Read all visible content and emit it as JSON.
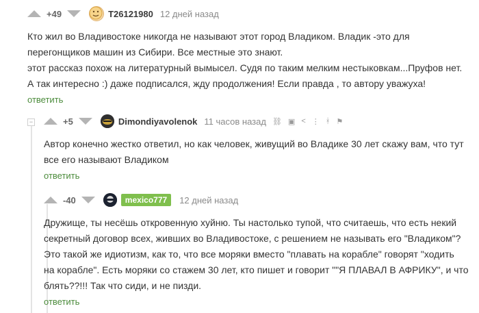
{
  "comments": [
    {
      "score": "+49",
      "author": "T26121980",
      "time": "12 дней назад",
      "lines": [
        "Кто жил во Владивостоке никогда не называют этот город Владиком. Владик -это для",
        "перегонщиков машин из Сибири. Все местные это знают.",
        "этот рассказ похож на литературный вымысел. Судя по таким мелким нестыковкам...Пруфов нет.",
        "А так интересно :) даже подписался, жду продолжения! Если правда , то автору уважуха!"
      ],
      "reply": "ответить"
    },
    {
      "score": "+5",
      "author": "Dimondiyavolenok",
      "time": "11 часов назад",
      "lines": [
        "Автор конечно жестко ответил, но как человек, живущий во Владике 30 лет скажу вам, что тут",
        "все его называют Владиком"
      ],
      "reply": "ответить",
      "tools": [
        "⛓",
        "▣",
        "<",
        "⋮",
        "ᚼ",
        "⚑"
      ]
    },
    {
      "score": "-40",
      "author": "mexico777",
      "time": "12 дней назад",
      "lines": [
        "Дружище, ты несёшь откровенную хуйню. Ты настолько тупой, что считаешь, что есть некий",
        "секретный договор всех, живших во Владивостоке, с решением не называть его \"Владиком\"?",
        "Это такой же идиотизм, как то, что все моряки вместо \"плавать на корабле\" говорят \"ходить",
        "на корабле\". Есть моряки со стажем 30 лет, кто пишет и говорит \"\"Я ПЛАВАЛ В АФРИКУ\", и что",
        "блять??!!! Так что сиди, и не пизди."
      ],
      "reply": "ответить"
    }
  ],
  "colors": {
    "reply": "#4b8b3b",
    "author_badge": "#7fbf4d",
    "vote_arrow": "#b4b4b4",
    "thread_line": "#e4e4e4"
  },
  "icons": [
    "vote-up-icon",
    "vote-down-icon",
    "avatar",
    "link-icon",
    "save-icon",
    "share-icon",
    "more-icon",
    "branch-icon",
    "report-icon",
    "collapse-icon"
  ]
}
